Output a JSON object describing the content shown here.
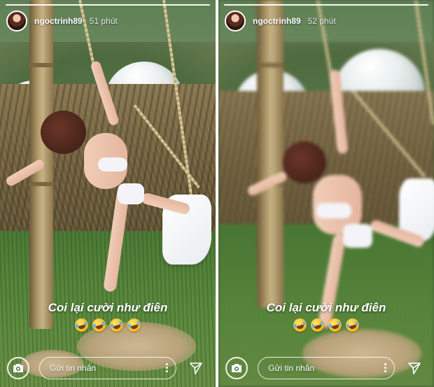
{
  "stories": [
    {
      "username": "ngoctrinh89",
      "time": "51 phút",
      "caption": "Coi lại cười như điên",
      "emojis": [
        "laughing-tears-emoji",
        "laughing-tears-emoji",
        "laughing-tears-emoji",
        "laughing-tears-emoji"
      ],
      "message_placeholder": "Gửi tin nhắn"
    },
    {
      "username": "ngoctrinh89",
      "time": "52 phút",
      "caption": "Coi lại cười như điên",
      "emojis": [
        "laughing-tears-emoji",
        "laughing-tears-emoji",
        "laughing-tears-emoji",
        "laughing-tears-emoji"
      ],
      "message_placeholder": "Gửi tin nhắn"
    }
  ],
  "icons": {
    "camera": "camera-icon",
    "more": "more-vertical-icon",
    "send": "send-icon"
  },
  "colors": {
    "ui_text": "#ffffff"
  }
}
